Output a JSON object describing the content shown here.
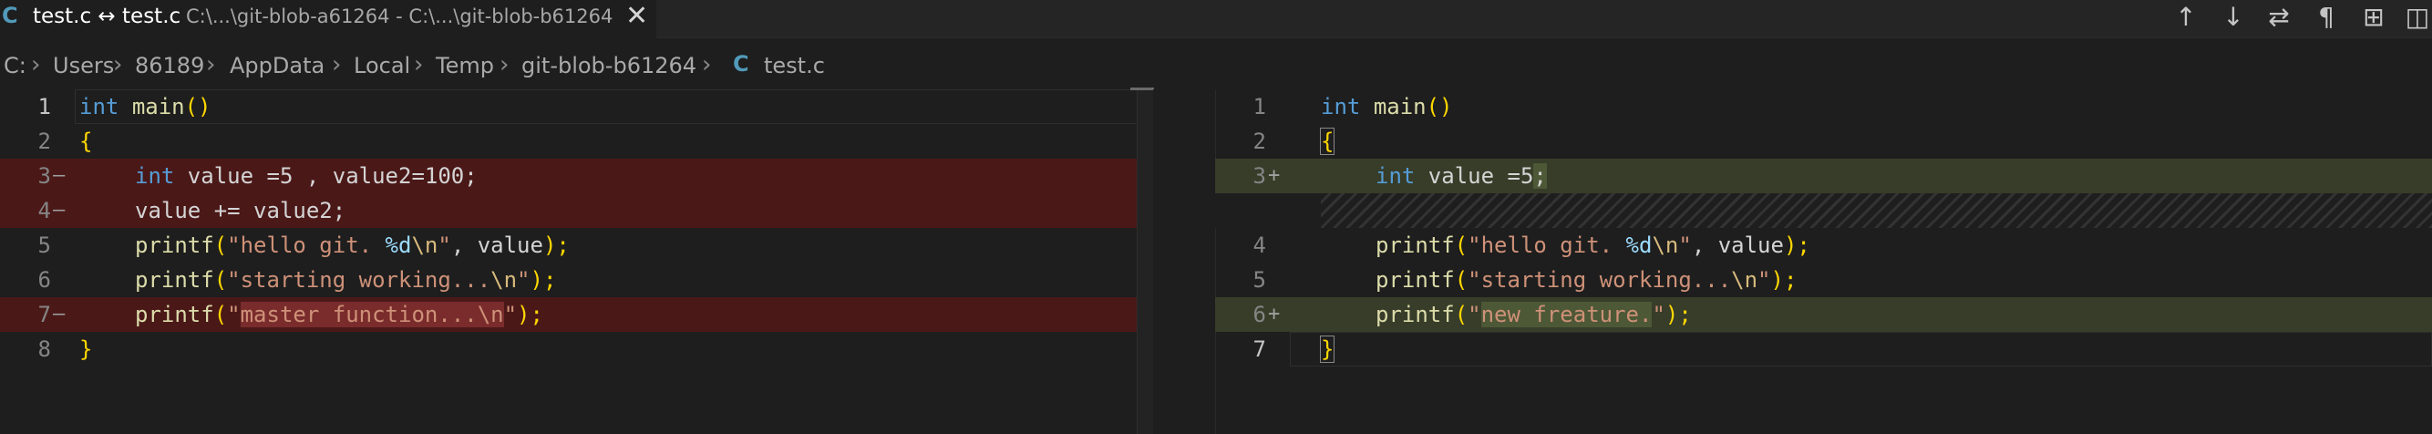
{
  "tab": {
    "lang_icon": "C",
    "title": "test.c ↔ test.c",
    "description": "C:\\...\\git-blob-a61264 - C:\\...\\git-blob-b61264",
    "close": "✕"
  },
  "toolbar": {
    "prev_change": "↑",
    "next_change": "↓",
    "swap": "⇄",
    "whitespace": "¶",
    "open_file": "⊞",
    "split": "◫"
  },
  "breadcrumb": {
    "items": [
      "C:",
      "Users",
      "86189",
      "AppData",
      "Local",
      "Temp",
      "git-blob-b61264"
    ],
    "separator": "›",
    "file_icon": "C",
    "file": "test.c"
  },
  "left_editor": {
    "lines": [
      {
        "num": "1",
        "marker": ""
      },
      {
        "num": "2",
        "marker": ""
      },
      {
        "num": "3",
        "marker": "—"
      },
      {
        "num": "4",
        "marker": "—"
      },
      {
        "num": "5",
        "marker": ""
      },
      {
        "num": "6",
        "marker": ""
      },
      {
        "num": "7",
        "marker": "—"
      },
      {
        "num": "8",
        "marker": ""
      }
    ],
    "code": {
      "l1_kw": "int",
      "l1_fn": "main",
      "l1_paren": "()",
      "l2": "{",
      "l3_kw": "int",
      "l3_rest": " value =5 , value2=100;",
      "l4": "value += value2;",
      "l5_fn": "printf",
      "l5_open": "(",
      "l5_str1": "\"hello git. ",
      "l5_fmt": "%d",
      "l5_esc": "\\n",
      "l5_str2": "\"",
      "l5_rest": ", value",
      "l5_close": ");",
      "l6_fn": "printf",
      "l6_open": "(",
      "l6_str1": "\"starting working...",
      "l6_esc": "\\n",
      "l6_str2": "\"",
      "l6_close": ");",
      "l7_fn": "printf",
      "l7_open": "(",
      "l7_str1": "\"",
      "l7_del": "master function...\\n",
      "l7_str2": "\"",
      "l7_close": ");",
      "l8": "}"
    }
  },
  "right_editor": {
    "lines": [
      {
        "num": "1",
        "marker": ""
      },
      {
        "num": "2",
        "marker": ""
      },
      {
        "num": "3",
        "marker": "+"
      },
      {
        "num": "4",
        "marker": ""
      },
      {
        "num": "5",
        "marker": ""
      },
      {
        "num": "6",
        "marker": "+"
      },
      {
        "num": "7",
        "marker": ""
      }
    ],
    "code": {
      "l1_kw": "int",
      "l1_fn": "main",
      "l1_paren": "()",
      "l2": "{",
      "l3_kw": "int",
      "l3_rest": " value =5",
      "l3_semi": ";",
      "l4_fn": "printf",
      "l4_open": "(",
      "l4_str1": "\"hello git. ",
      "l4_fmt": "%d",
      "l4_esc": "\\n",
      "l4_str2": "\"",
      "l4_rest": ", value",
      "l4_close": ");",
      "l5_fn": "printf",
      "l5_open": "(",
      "l5_str1": "\"starting working...",
      "l5_esc": "\\n",
      "l5_str2": "\"",
      "l5_close": ");",
      "l6_fn": "printf",
      "l6_open": "(",
      "l6_str1": "\"",
      "l6_ins": "new freature.",
      "l6_str2": "\"",
      "l6_close": ");",
      "l7": "}"
    }
  },
  "colors": {
    "background": "#1e1e1e",
    "removed_line": "#4b1818",
    "inserted_line": "#373d29",
    "keyword": "#569cd6",
    "function": "#dcdcaa",
    "string": "#ce9178"
  }
}
